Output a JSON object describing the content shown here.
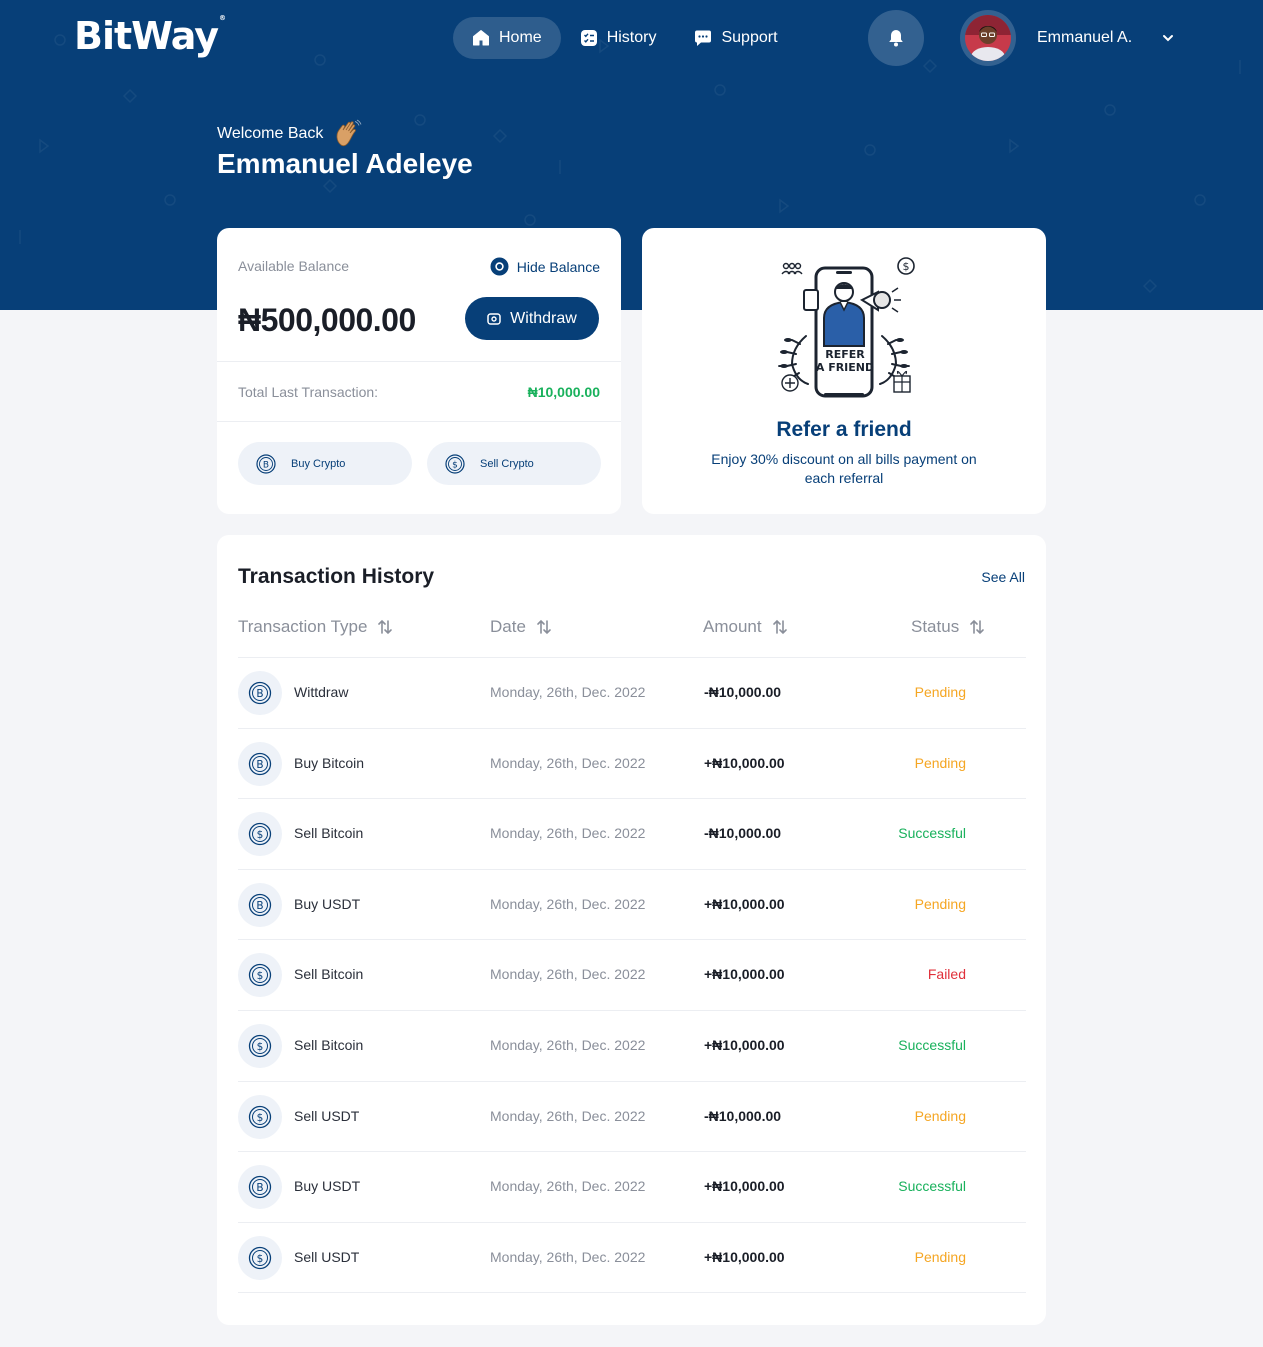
{
  "brand": {
    "logo_text": "BitWay",
    "logo_mark": "®"
  },
  "nav": {
    "items": [
      {
        "label": "Home",
        "icon": "home-icon",
        "active": true
      },
      {
        "label": "History",
        "icon": "history-icon",
        "active": false
      },
      {
        "label": "Support",
        "icon": "chat-icon",
        "active": false
      }
    ]
  },
  "user": {
    "short_name": "Emmanuel A."
  },
  "hero": {
    "welcome": "Welcome Back",
    "name": "Emmanuel Adeleye"
  },
  "balance": {
    "label": "Available Balance",
    "hide_label": "Hide Balance",
    "amount": "₦500,000.00",
    "withdraw_label": "Withdraw",
    "last_tx_label": "Total Last Transaction:",
    "last_tx_value": "₦10,000.00",
    "buy_label": "Buy Crypto",
    "sell_label": "Sell Crypto"
  },
  "refer": {
    "illustration_text_1": "REFER",
    "illustration_text_2": "A FRIEND",
    "title": "Refer a friend",
    "description": "Enjoy 30% discount on all bills payment on each referral"
  },
  "transactions": {
    "title": "Transaction History",
    "see_all": "See All",
    "columns": [
      "Transaction Type",
      "Date",
      "Amount",
      "Status"
    ],
    "rows": [
      {
        "icon": "bitcoin-icon",
        "type": "Wittdraw",
        "date": "Monday, 26th, Dec. 2022",
        "amount": "-₦10,000.00",
        "status": "Pending"
      },
      {
        "icon": "bitcoin-icon",
        "type": "Buy Bitcoin",
        "date": "Monday, 26th, Dec. 2022",
        "amount": "+₦10,000.00",
        "status": "Pending"
      },
      {
        "icon": "dollar-icon",
        "type": "Sell Bitcoin",
        "date": "Monday, 26th, Dec. 2022",
        "amount": "-₦10,000.00",
        "status": "Successful"
      },
      {
        "icon": "bitcoin-icon",
        "type": "Buy USDT",
        "date": "Monday, 26th, Dec. 2022",
        "amount": "+₦10,000.00",
        "status": "Pending"
      },
      {
        "icon": "dollar-icon",
        "type": "Sell Bitcoin",
        "date": "Monday, 26th, Dec. 2022",
        "amount": "+₦10,000.00",
        "status": "Failed"
      },
      {
        "icon": "dollar-icon",
        "type": "Sell Bitcoin",
        "date": "Monday, 26th, Dec. 2022",
        "amount": "+₦10,000.00",
        "status": "Successful"
      },
      {
        "icon": "dollar-icon",
        "type": "Sell USDT",
        "date": "Monday, 26th, Dec. 2022",
        "amount": "-₦10,000.00",
        "status": "Pending"
      },
      {
        "icon": "bitcoin-icon",
        "type": "Buy USDT",
        "date": "Monday, 26th, Dec. 2022",
        "amount": "+₦10,000.00",
        "status": "Successful"
      },
      {
        "icon": "dollar-icon",
        "type": "Sell USDT",
        "date": "Monday, 26th, Dec. 2022",
        "amount": "+₦10,000.00",
        "status": "Pending"
      }
    ]
  },
  "colors": {
    "primary": "#073f78",
    "pending": "#f5a623",
    "successful": "#19b15c",
    "failed": "#e0303a"
  }
}
